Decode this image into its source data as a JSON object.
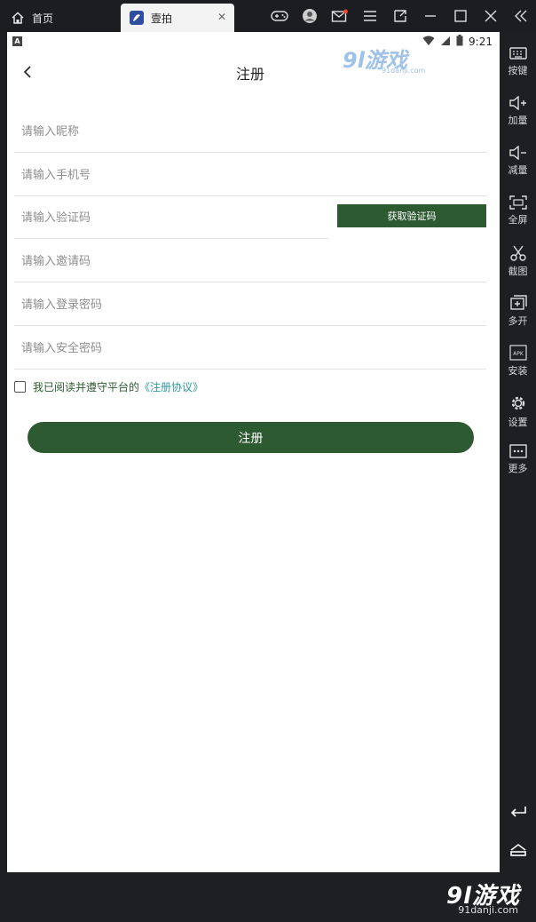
{
  "titlebar": {
    "home_tab": "首页",
    "app_tab": "壹拍",
    "close_glyph": "✕"
  },
  "sidebar": {
    "items": [
      {
        "label": "按键",
        "icon": "keyboard-icon"
      },
      {
        "label": "加量",
        "icon": "volume-up-icon"
      },
      {
        "label": "减量",
        "icon": "volume-down-icon"
      },
      {
        "label": "全屏",
        "icon": "fullscreen-icon"
      },
      {
        "label": "截图",
        "icon": "scissors-icon"
      },
      {
        "label": "多开",
        "icon": "multi-instance-icon"
      },
      {
        "label": "安装",
        "icon": "apk-install-icon"
      },
      {
        "label": "设置",
        "icon": "gear-icon"
      },
      {
        "label": "更多",
        "icon": "more-icon"
      }
    ]
  },
  "statusbar": {
    "badge": "A",
    "time": "9:21"
  },
  "page": {
    "title": "注册",
    "fields": {
      "nickname": "请输入昵称",
      "phone": "请输入手机号",
      "code": "请输入验证码",
      "invite": "请输入邀请码",
      "login_password": "请输入登录密码",
      "safe_password": "请输入安全密码"
    },
    "get_code_button": "获取验证码",
    "agree_text": "我已阅读并遵守平台的",
    "agree_link": "《注册协议》",
    "submit_button": "注册"
  },
  "watermark": {
    "logo_top": "9l游戏",
    "site_top": "91danji.com",
    "logo_bottom": "9l游戏",
    "site_bottom": "91danji.com"
  },
  "colors": {
    "accent": "#2e5a31",
    "link": "#2f9a9a",
    "chrome_bg": "#1e1f23"
  }
}
